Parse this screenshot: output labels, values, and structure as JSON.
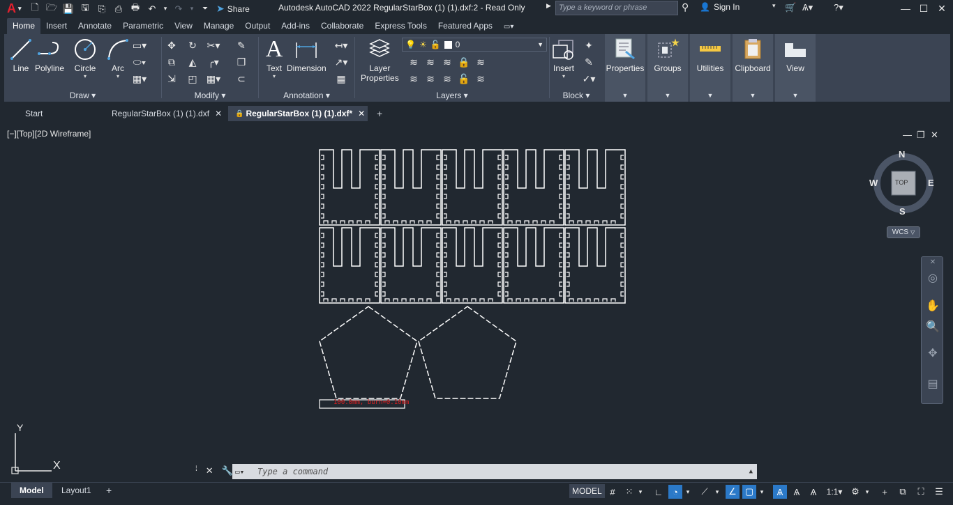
{
  "titlebar": {
    "logo": "A",
    "share_label": "Share",
    "title": "Autodesk AutoCAD 2022   RegularStarBox (1) (1).dxf:2 - Read Only",
    "search_placeholder": "Type a keyword or phrase",
    "signin_label": "Sign In"
  },
  "ribbon_tabs": [
    "Home",
    "Insert",
    "Annotate",
    "Parametric",
    "View",
    "Manage",
    "Output",
    "Add-ins",
    "Collaborate",
    "Express Tools",
    "Featured Apps"
  ],
  "ribbon": {
    "draw": {
      "title": "Draw",
      "line": "Line",
      "polyline": "Polyline",
      "circle": "Circle",
      "arc": "Arc"
    },
    "modify": {
      "title": "Modify"
    },
    "annotation": {
      "title": "Annotation",
      "text": "Text",
      "dimension": "Dimension"
    },
    "layers": {
      "title": "Layers",
      "layer_properties": "Layer\nProperties",
      "current_layer": "0"
    },
    "block": {
      "title": "Block",
      "insert": "Insert"
    },
    "properties": "Properties",
    "groups": "Groups",
    "utilities": "Utilities",
    "clipboard": "Clipboard",
    "view": "View"
  },
  "doc_tabs": {
    "start": "Start",
    "tab1": "RegularStarBox (1) (1).dxf",
    "tab2": "RegularStarBox (1) (1).dxf*"
  },
  "viewport": {
    "label": "[−][Top][2D Wireframe]",
    "compass": {
      "n": "N",
      "s": "S",
      "e": "E",
      "w": "W",
      "top": "TOP",
      "wcs": "WCS"
    },
    "drawing_annotation": "100.0mm, burn=0.10mm",
    "ucs_x": "X",
    "ucs_y": "Y"
  },
  "command": {
    "placeholder": "Type a command"
  },
  "status": {
    "model_tab": "Model",
    "layout_tab": "Layout1",
    "model_btn": "MODEL",
    "scale": "1:1"
  }
}
